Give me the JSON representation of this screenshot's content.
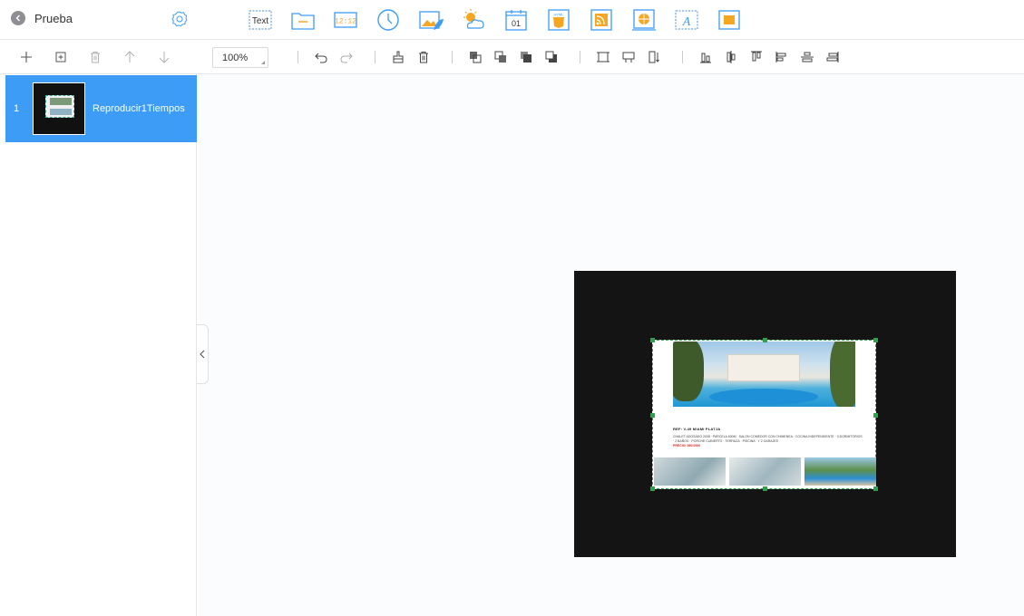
{
  "project": {
    "title": "Prueba"
  },
  "widgets": [
    {
      "name": "text-widget",
      "label": "Text"
    },
    {
      "name": "folder-widget",
      "label": ""
    },
    {
      "name": "digital-clock-widget",
      "label": "12:12"
    },
    {
      "name": "analog-clock-widget",
      "label": ""
    },
    {
      "name": "image-widget",
      "label": ""
    },
    {
      "name": "weather-widget",
      "label": ""
    },
    {
      "name": "date-widget",
      "label": "01"
    },
    {
      "name": "html-widget",
      "label": "HTML"
    },
    {
      "name": "rss-widget",
      "label": ""
    },
    {
      "name": "web-widget",
      "label": ""
    },
    {
      "name": "marquee-text-widget",
      "label": "A"
    },
    {
      "name": "color-block-widget",
      "label": ""
    }
  ],
  "toolbar": {
    "zoom": "100%"
  },
  "slides": [
    {
      "number": "1",
      "name": "Reproducir1Tiempos"
    }
  ],
  "listing": {
    "ref": "REF: V-49   MIAMI PLATJA",
    "desc": "CHALET ADOSADO 2008 · PARCELA 600M · SALON COMEDOR CON CHIMENEA · COCINA INDEPENDIENTE · 3 DORMITORIOS · 2 BAÑOS · PORCHE CUBIERTO · TERRAZA · PISCINA · Y 2 GARAJES",
    "price": "PRECIO: 360.000€"
  },
  "colors": {
    "accent": "#3d9cf5",
    "widget_orange": "#f5a623",
    "selection": "#2aa44a",
    "stage": "#141414"
  }
}
